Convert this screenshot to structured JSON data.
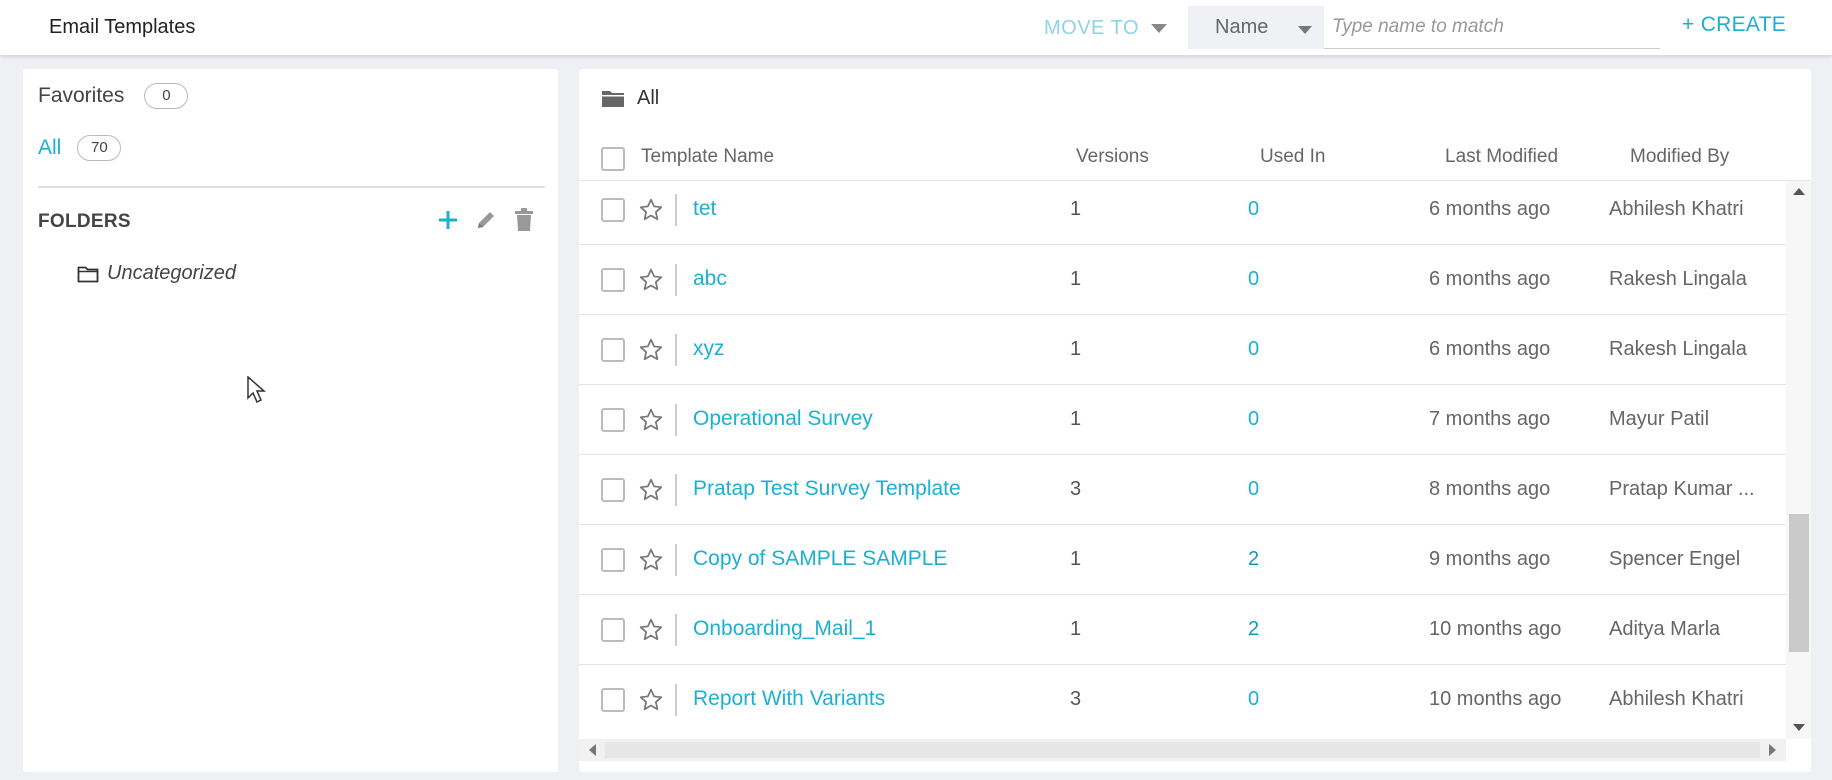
{
  "header": {
    "title": "Email Templates",
    "move_to": "MOVE TO",
    "search_type": "Name",
    "search_placeholder": "Type name to match",
    "create": "+ CREATE"
  },
  "sidebar": {
    "favorites_label": "Favorites",
    "favorites_count": "0",
    "all_label": "All",
    "all_count": "70",
    "folders_title": "FOLDERS",
    "folders": [
      "Uncategorized"
    ]
  },
  "main": {
    "breadcrumb": "All",
    "columns": {
      "name": "Template Name",
      "versions": "Versions",
      "used_in": "Used In",
      "last_modified": "Last Modified",
      "modified_by": "Modified By"
    },
    "rows": [
      {
        "name": "tet",
        "versions": "1",
        "used_in": "0",
        "last_modified": "6 months ago",
        "modified_by": "Abhilesh Khatri"
      },
      {
        "name": "abc",
        "versions": "1",
        "used_in": "0",
        "last_modified": "6 months ago",
        "modified_by": "Rakesh Lingala"
      },
      {
        "name": "xyz",
        "versions": "1",
        "used_in": "0",
        "last_modified": "6 months ago",
        "modified_by": "Rakesh Lingala"
      },
      {
        "name": "Operational Survey",
        "versions": "1",
        "used_in": "0",
        "last_modified": "7 months ago",
        "modified_by": "Mayur Patil"
      },
      {
        "name": "Pratap Test Survey Template",
        "versions": "3",
        "used_in": "0",
        "last_modified": "8 months ago",
        "modified_by": "Pratap Kumar ..."
      },
      {
        "name": "Copy of SAMPLE SAMPLE",
        "versions": "1",
        "used_in": "2",
        "last_modified": "9 months ago",
        "modified_by": "Spencer Engel"
      },
      {
        "name": "Onboarding_Mail_1",
        "versions": "1",
        "used_in": "2",
        "last_modified": "10 months ago",
        "modified_by": "Aditya Marla"
      },
      {
        "name": "Report With Variants",
        "versions": "3",
        "used_in": "0",
        "last_modified": "10 months ago",
        "modified_by": "Abhilesh Khatri"
      }
    ]
  },
  "colors": {
    "accent": "#1bb0d3",
    "move_to": "#8fd3e6",
    "background": "#eef0f3"
  },
  "icons": [
    "folder-icon",
    "folder-outline-icon",
    "plus-icon",
    "pencil-icon",
    "trash-icon",
    "star-outline-icon",
    "cursor-arrow-icon"
  ]
}
